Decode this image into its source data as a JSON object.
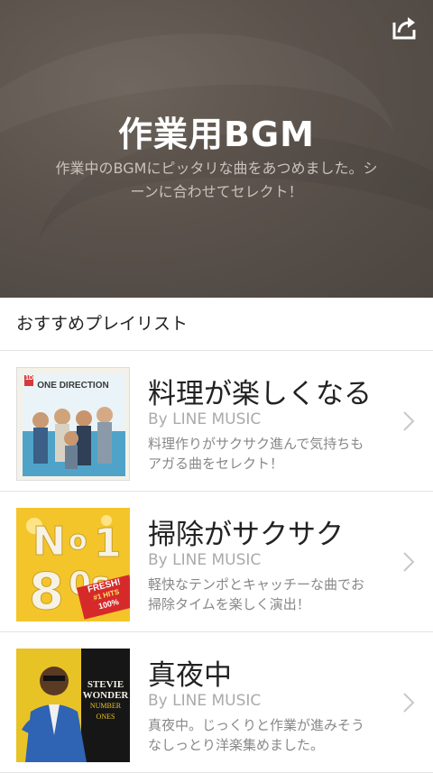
{
  "header": {
    "title": "作業用BGM",
    "description": "作業中のBGMにピッタリな曲をあつめました。シーンに合わせてセレクト！",
    "share_icon": "share-icon"
  },
  "section": {
    "title": "おすすめプレイリスト"
  },
  "playlists": [
    {
      "name": "料理が楽しくなる",
      "by": "By LINE MUSIC",
      "desc": "料理作りがサクサク進んで気持ちもアガる曲をセレクト！",
      "cover_text": "ONE DIRECTION",
      "cover_badge": "1D"
    },
    {
      "name": "掃除がサクサク",
      "by": "By LINE MUSIC",
      "desc": "軽快なテンポとキャッチーな曲でお掃除タイムを楽しく演出！",
      "cover_text_1": "FRESH!",
      "cover_text_2": "#1 HITS",
      "cover_text_3": "100%"
    },
    {
      "name": "真夜中",
      "by": "By LINE MUSIC",
      "desc": "真夜中。じっくりと作業が進みそうなしっとり洋楽集めました。",
      "cover_text_1": "STEVIE",
      "cover_text_2": "WONDER",
      "cover_text_3": "NUMBER",
      "cover_text_4": "ONES"
    }
  ],
  "colors": {
    "hero_bg": "#5a524b",
    "chevron": "#c8c8c8"
  }
}
